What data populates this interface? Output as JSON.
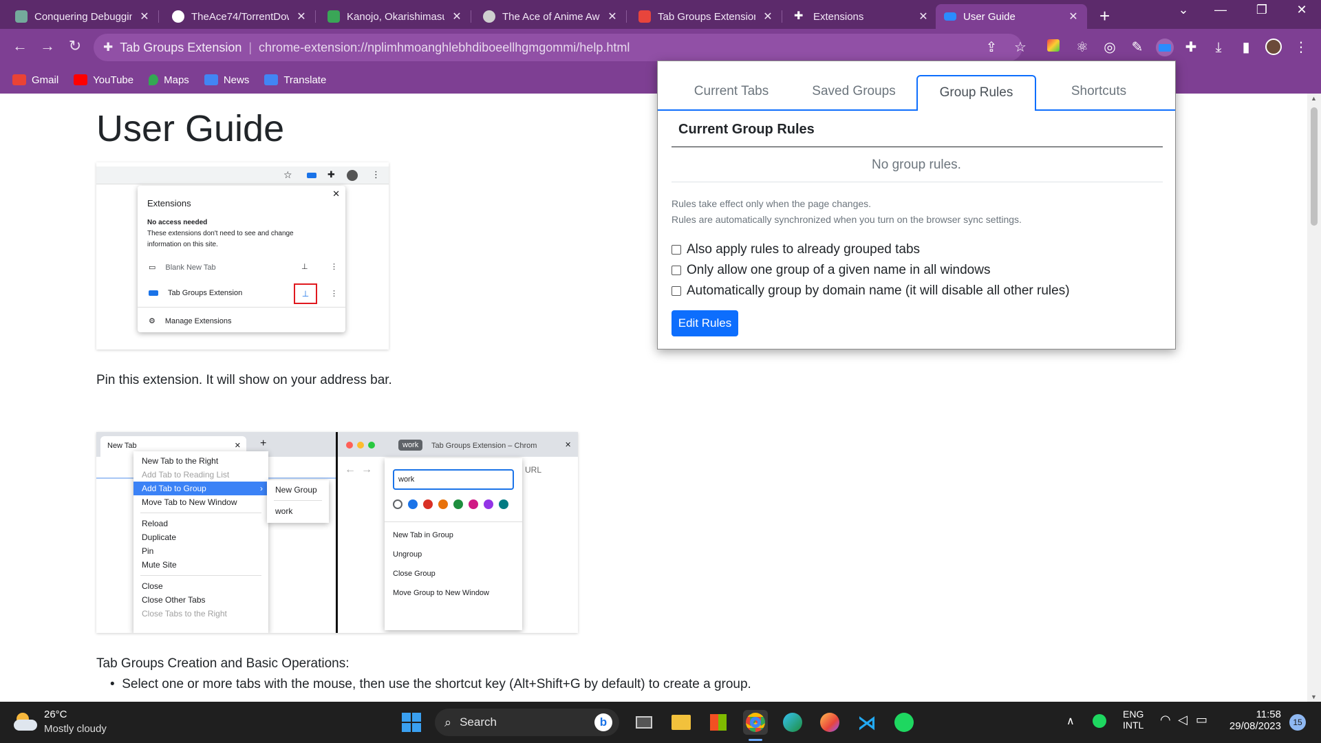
{
  "browser": {
    "tabs": [
      {
        "title": "Conquering Debuggin",
        "color": "#74aa9c"
      },
      {
        "title": "TheAce74/TorrentDow",
        "color": "#ffffff"
      },
      {
        "title": "Kanojo, Okarishimasu",
        "color": "#3aa657"
      },
      {
        "title": "The Ace of Anime Aw",
        "color": "#cfcfcf"
      },
      {
        "title": "Tab Groups Extension",
        "color": "#e8453c"
      },
      {
        "title": "Extensions",
        "color": "#ffffff"
      },
      {
        "title": "User Guide",
        "color": "#2a8cff"
      }
    ],
    "active_tab": 6,
    "close_glyph": "✕",
    "new_tab_glyph": "+",
    "omnibox": {
      "site": "Tab Groups Extension",
      "divider": "|",
      "url": "chrome-extension://nplimhmoanghlebhdiboeellhgmgommi/help.html"
    },
    "bookmarks": [
      {
        "label": "Gmail",
        "color": "#ea4335"
      },
      {
        "label": "YouTube",
        "color": "#ff0000"
      },
      {
        "label": "Maps",
        "color": "#34a853"
      },
      {
        "label": "News",
        "color": "#4285f4"
      },
      {
        "label": "Translate",
        "color": "#4285f4"
      }
    ],
    "theme_color": "#7e3f93"
  },
  "page": {
    "title": "User Guide",
    "caption1": "Pin this extension. It will show on your address bar.",
    "section_heading": "Tab Groups Creation and Basic Operations:",
    "bullet1": "Select one or more tabs with the mouse, then use the shortcut key (Alt+Shift+G by default) to create a group.",
    "screenshot1": {
      "header": "Extensions",
      "subheader": "No access needed",
      "desc_line1": "These extensions don't need to see and change",
      "desc_line2": "information on this site.",
      "item1": "Blank New Tab",
      "item2": "Tab Groups Extension",
      "manage": "Manage Extensions"
    },
    "screenshot2": {
      "tab_label": "New Tab",
      "menu": [
        "New Tab to the Right",
        "Add Tab to Reading List",
        "Add Tab to Group",
        "Move Tab to New Window",
        "Reload",
        "Duplicate",
        "Pin",
        "Mute Site",
        "Close",
        "Close Other Tabs",
        "Close Tabs to the Right"
      ],
      "submenu": [
        "New Group",
        "work"
      ],
      "group_chip": "work",
      "tab2_label": "Tab Groups Extension – Chrom",
      "url_hint": "URL",
      "name_input": "work",
      "group_colors": [
        "#5f6368",
        "#1a73e8",
        "#d93025",
        "#e8710a",
        "#1e8e3e",
        "#d01884",
        "#9334e6",
        "#007b83"
      ],
      "group_menu": [
        "New Tab in Group",
        "Ungroup",
        "Close Group",
        "Move Group to New Window"
      ]
    }
  },
  "popup": {
    "tabs": [
      "Current Tabs",
      "Saved Groups",
      "Group Rules",
      "Shortcuts"
    ],
    "active_tab": 2,
    "heading": "Current Group Rules",
    "empty_text": "No group rules.",
    "note1": "Rules take effect only when the page changes.",
    "note2": "Rules are automatically synchronized when you turn on the browser sync settings.",
    "options": [
      {
        "label": "Also apply rules to already grouped tabs",
        "checked": false
      },
      {
        "label": "Only allow one group of a given name in all windows",
        "checked": false
      },
      {
        "label": "Automatically group by domain name (it will disable all other rules)",
        "checked": false
      }
    ],
    "edit_button": "Edit Rules",
    "accent": "#0d6efd"
  },
  "taskbar": {
    "temp": "26°C",
    "weather": "Mostly cloudy",
    "search": "Search",
    "lang1": "ENG",
    "lang2": "INTL",
    "time": "11:58",
    "date": "29/08/2023",
    "badge": "15"
  }
}
